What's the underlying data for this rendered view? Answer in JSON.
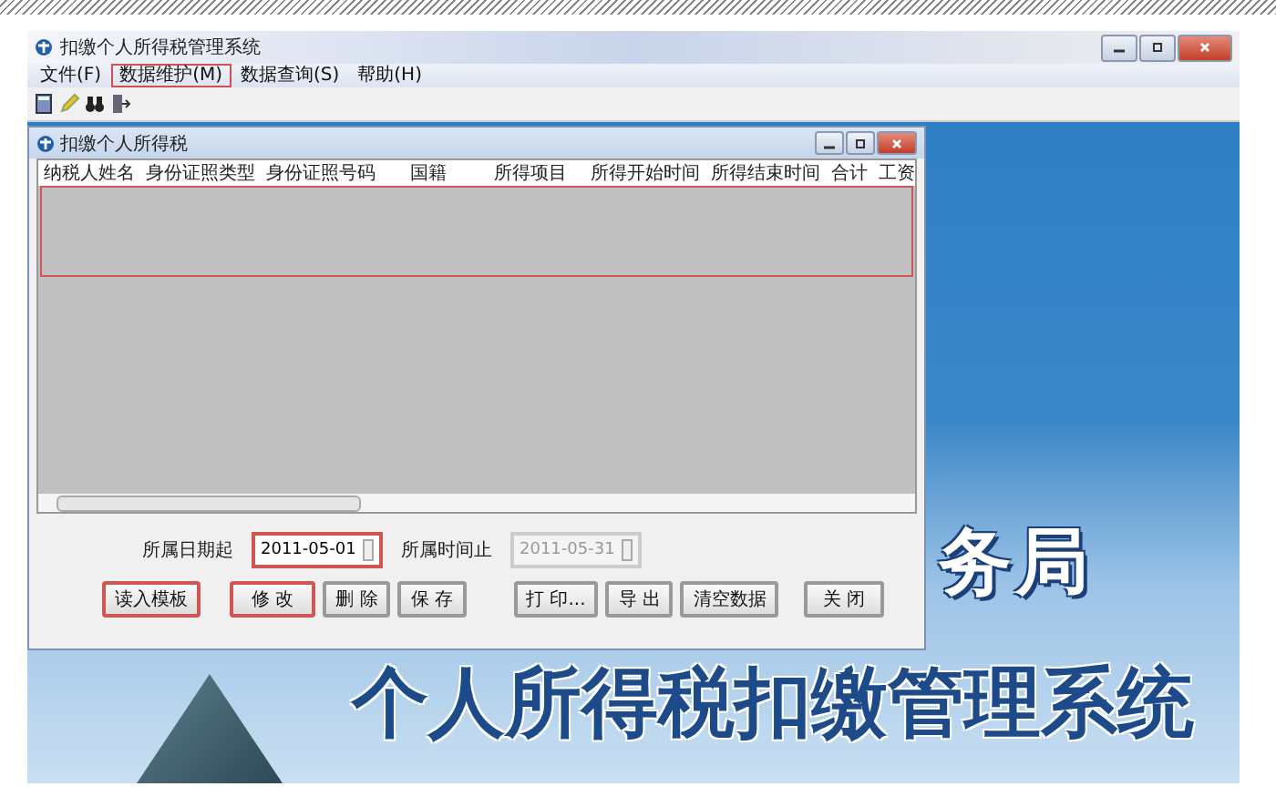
{
  "app_window": {
    "title": "扣缴个人所得税管理系统"
  },
  "menu": [
    {
      "label": "文件(F)",
      "highlighted": false
    },
    {
      "label": "数据维护(M)",
      "highlighted": true
    },
    {
      "label": "数据查询(S)",
      "highlighted": false
    },
    {
      "label": "帮助(H)",
      "highlighted": false
    }
  ],
  "background": {
    "banner_partial": "务局",
    "banner_title": "个人所得税扣缴管理系统"
  },
  "dialog": {
    "title": "扣缴个人所得税",
    "table": {
      "columns": [
        "纳税人姓名",
        "身份证照类型",
        "身份证照号码",
        "国籍",
        "所得项目",
        "所得开始时间",
        "所得结束时间",
        "合计",
        "工资"
      ],
      "rows_highlighted": true
    },
    "date_from": {
      "label": "所属日期起",
      "value": "2011-05-01",
      "highlighted": true,
      "disabled": false
    },
    "date_to": {
      "label": "所属时间止",
      "value": "2011-05-31",
      "highlighted": false,
      "disabled": true
    },
    "buttons": [
      {
        "label": "读入模板",
        "highlighted": true
      },
      {
        "label": "修 改",
        "highlighted": true
      },
      {
        "label": "删 除",
        "highlighted": false
      },
      {
        "label": "保 存",
        "highlighted": false
      },
      {
        "label": "打 印...",
        "highlighted": false
      },
      {
        "label": "导 出",
        "highlighted": false
      },
      {
        "label": "清空数据",
        "highlighted": false
      },
      {
        "label": "关 闭",
        "highlighted": false
      }
    ]
  }
}
